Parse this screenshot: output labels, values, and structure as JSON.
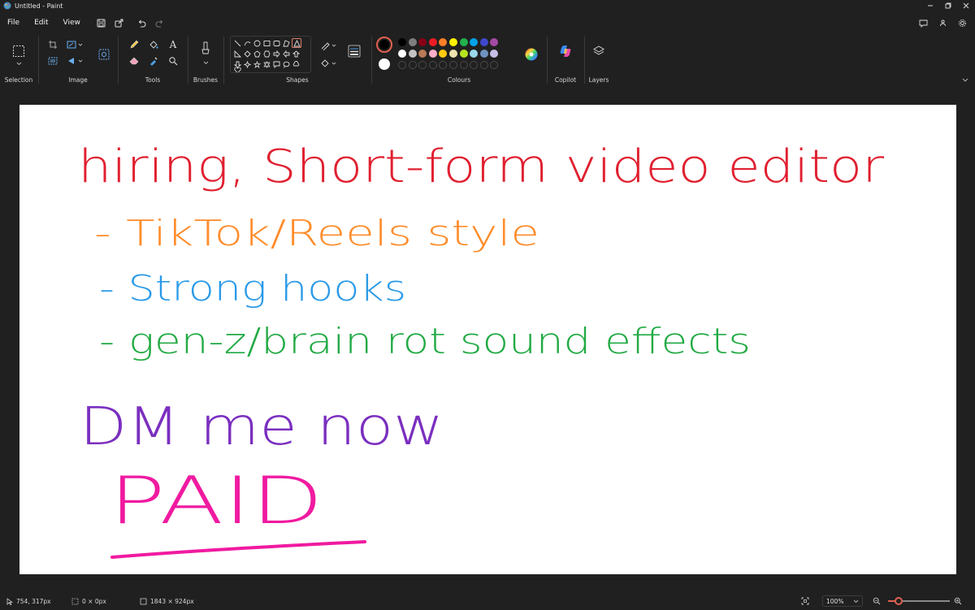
{
  "window": {
    "title": "Untitled - Paint"
  },
  "menu": {
    "items": [
      "File",
      "Edit",
      "View"
    ]
  },
  "ribbon": {
    "groups": {
      "selection": "Selection",
      "image": "Image",
      "tools": "Tools",
      "brushes": "Brushes",
      "shapes": "Shapes",
      "colours": "Colours",
      "copilot": "Copilot",
      "layers": "Layers"
    },
    "tool_text_glyph": "A",
    "palette_row1": [
      "#000000",
      "#7f7f7f",
      "#880015",
      "#ed1c24",
      "#ff7f27",
      "#fff200",
      "#22b14c",
      "#00a2e8",
      "#3f48cc",
      "#a349a4"
    ],
    "palette_row2": [
      "#ffffff",
      "#c3c3c3",
      "#b97a57",
      "#ffaec9",
      "#ffc90e",
      "#efe4b0",
      "#b5e61d",
      "#99d9ea",
      "#7092be",
      "#c8bfe7"
    ],
    "palette_row3_empty_count": 10,
    "primary_color": "#000000",
    "secondary_color": "#ffffff"
  },
  "canvas": {
    "lines": [
      {
        "text": "hiring, Short-form video editor",
        "color": "#e02030"
      },
      {
        "text": "- TikTok/Reels style",
        "color": "#ff8c2a"
      },
      {
        "text": "- Strong hooks",
        "color": "#2a9ae8"
      },
      {
        "text": "- gen-z/brain rot sound effects",
        "color": "#22aa44"
      },
      {
        "text": "DM me now",
        "color": "#7b2fbf"
      },
      {
        "text": "PAID",
        "color": "#f01aa0"
      }
    ],
    "underline_color": "#f01aa0"
  },
  "status": {
    "cursor": "754, 317px",
    "selection": "0 × 0px",
    "canvas_size": "1843 × 924px",
    "zoom": "100%",
    "zoom_fraction": 0.17
  },
  "colors": {
    "accent": "#e06050",
    "background": "#202020"
  }
}
